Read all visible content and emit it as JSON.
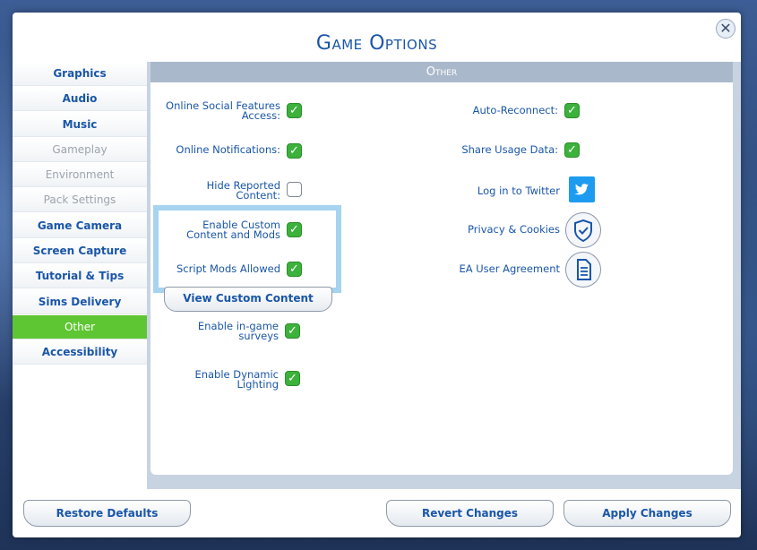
{
  "window": {
    "title": "Game Options",
    "close_glyph": "✕"
  },
  "sidebar": {
    "items": [
      {
        "label": "Graphics",
        "state": "normal"
      },
      {
        "label": "Audio",
        "state": "normal"
      },
      {
        "label": "Music",
        "state": "normal"
      },
      {
        "label": "Gameplay",
        "state": "disabled"
      },
      {
        "label": "Environment",
        "state": "disabled"
      },
      {
        "label": "Pack Settings",
        "state": "disabled"
      },
      {
        "label": "Game Camera",
        "state": "normal"
      },
      {
        "label": "Screen Capture",
        "state": "normal"
      },
      {
        "label": "Tutorial & Tips",
        "state": "normal"
      },
      {
        "label": "Sims Delivery",
        "state": "normal"
      },
      {
        "label": "Other",
        "state": "active"
      },
      {
        "label": "Accessibility",
        "state": "normal"
      }
    ]
  },
  "panel": {
    "header": "Other",
    "left_options": [
      {
        "label": "Online Social Features Access:",
        "checked": true
      },
      {
        "label": "Online Notifications:",
        "checked": true
      },
      {
        "label": "Hide Reported Content:",
        "checked": false
      },
      {
        "label": "Enable Custom Content and Mods",
        "checked": true
      },
      {
        "label": "Script Mods Allowed",
        "checked": true
      },
      {
        "label": "Enable in-game surveys",
        "checked": true
      },
      {
        "label": "Enable Dynamic Lighting",
        "checked": true
      }
    ],
    "view_custom_content": "View Custom Content",
    "right_options": [
      {
        "label": "Auto-Reconnect:",
        "checked": true
      },
      {
        "label": "Share Usage Data:",
        "checked": true
      }
    ],
    "links": {
      "twitter": "Log in to Twitter",
      "privacy": "Privacy & Cookies",
      "user_agreement": "EA User Agreement"
    },
    "check_glyph": "✓"
  },
  "footer": {
    "restore": "Restore Defaults",
    "revert": "Revert Changes",
    "apply": "Apply Changes"
  },
  "colors": {
    "accent": "#1a56a8",
    "active_tab": "#5ec633",
    "checkbox_on": "#3cb13c",
    "highlight": "#a6d3ef"
  }
}
